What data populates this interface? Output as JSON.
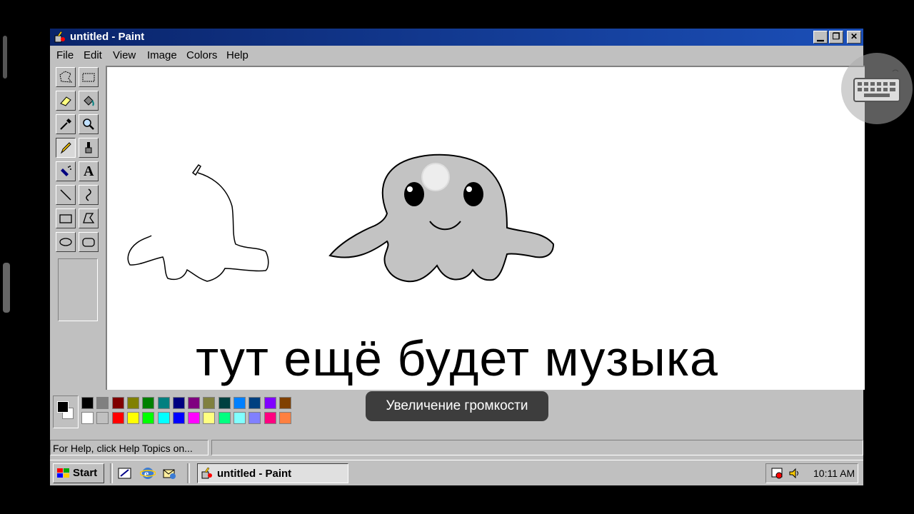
{
  "window": {
    "title": "untitled - Paint",
    "controls": [
      "minimize-icon",
      "maximize-icon",
      "close-icon"
    ]
  },
  "menu": [
    "File",
    "Edit",
    "View",
    "Image",
    "Colors",
    "Help"
  ],
  "tools": [
    "free-form-select-icon",
    "rect-select-icon",
    "eraser-icon",
    "fill-icon",
    "pick-color-icon",
    "magnifier-icon",
    "pencil-icon",
    "brush-icon",
    "airbrush-icon",
    "text-icon",
    "line-icon",
    "curve-icon",
    "rectangle-icon",
    "polygon-icon",
    "ellipse-icon",
    "rounded-rectangle-icon"
  ],
  "text_tool_glyph": "A",
  "selected_tool": "pencil",
  "palette": {
    "foreground": "#000000",
    "background": "#ffffff",
    "top_row": [
      "#000000",
      "#808080",
      "#800000",
      "#808000",
      "#008000",
      "#008080",
      "#000080",
      "#800080",
      "#808040",
      "#004040",
      "#0080ff",
      "#004080",
      "#8000ff",
      "#804000"
    ],
    "bottom_row": [
      "#ffffff",
      "#c0c0c0",
      "#ff0000",
      "#ffff00",
      "#00ff00",
      "#00ffff",
      "#0000ff",
      "#ff00ff",
      "#ffff80",
      "#00ff80",
      "#80ffff",
      "#8080ff",
      "#ff0080",
      "#ff8040"
    ]
  },
  "status": {
    "help_text": "For Help, click Help Topics on..."
  },
  "taskbar": {
    "start_label": "Start",
    "task_label": "untitled - Paint",
    "clock": "10:11 AM"
  },
  "overlay": {
    "subtitle": "тут ещё будет музыка",
    "toast": "Увеличение громкости"
  }
}
